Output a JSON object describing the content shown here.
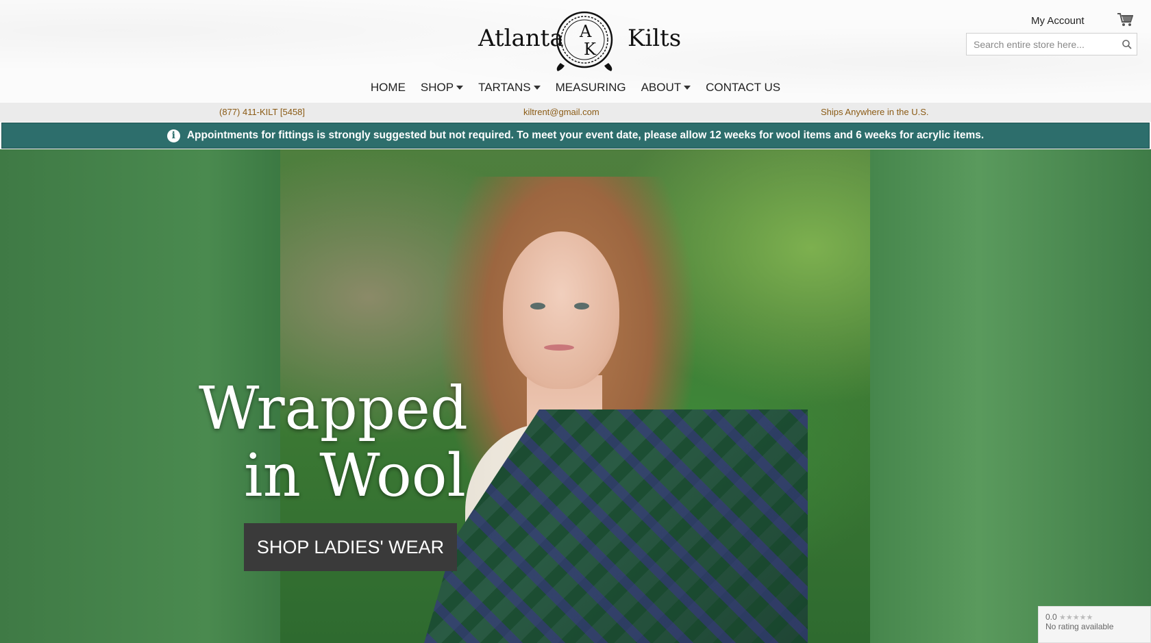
{
  "brand": {
    "name_left": "Atlanta",
    "name_right": "Kilts",
    "monogram_top": "A",
    "monogram_bottom": "K"
  },
  "header": {
    "account_label": "My Account",
    "search_placeholder": "Search entire store here...",
    "cart_icon": "shopping-cart-icon",
    "search_icon": "search-icon"
  },
  "nav": {
    "items": [
      {
        "label": "HOME",
        "dropdown": false
      },
      {
        "label": "SHOP",
        "dropdown": true
      },
      {
        "label": "TARTANS",
        "dropdown": true
      },
      {
        "label": "MEASURING",
        "dropdown": false
      },
      {
        "label": "ABOUT",
        "dropdown": true
      },
      {
        "label": "CONTACT US",
        "dropdown": false
      }
    ]
  },
  "infobar": {
    "phone": "(877) 411-KILT [5458]",
    "email": "kiltrent@gmail.com",
    "shipping": "Ships Anywhere in the U.S."
  },
  "notice": {
    "icon": "info-icon",
    "text": "Appointments for fittings is strongly suggested but not required. To meet your event date, please allow 12 weeks for wool items and 6 weeks for acrylic items."
  },
  "hero": {
    "title_line1": "Wrapped",
    "title_line2": "in Wool",
    "button_label": "SHOP LADIES' WEAR"
  },
  "rating": {
    "score": "0.0",
    "stars": "★★★★★",
    "text": "No rating available"
  },
  "colors": {
    "notice_bg": "#2d6e6c",
    "infobar_text": "#8a5a14",
    "button_bg": "#3a3a3a"
  }
}
